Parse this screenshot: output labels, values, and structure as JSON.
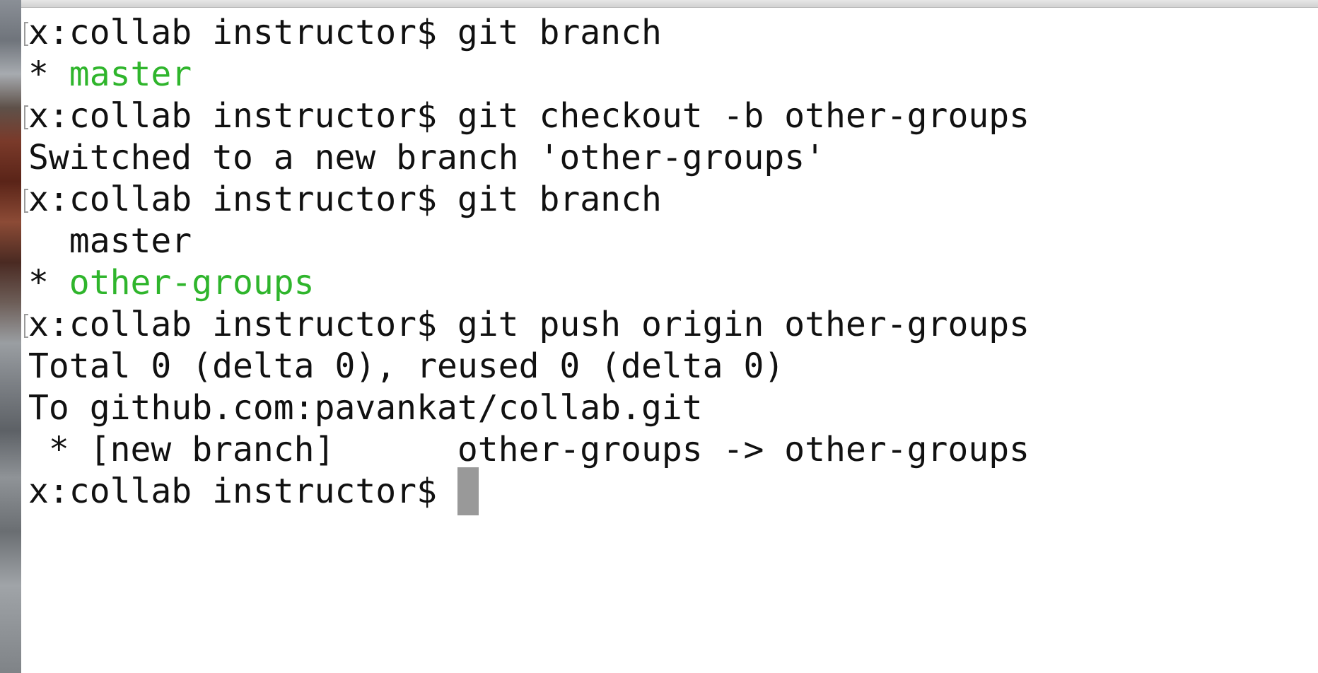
{
  "terminal": {
    "prompt": "x:collab instructor$ ",
    "lines": [
      {
        "type": "prompt",
        "command": "git branch"
      },
      {
        "type": "branch",
        "star": "* ",
        "name": "master"
      },
      {
        "type": "prompt",
        "command": "git checkout -b other-groups"
      },
      {
        "type": "output",
        "text": "Switched to a new branch 'other-groups'"
      },
      {
        "type": "prompt",
        "command": "git branch"
      },
      {
        "type": "output",
        "text": "  master"
      },
      {
        "type": "branch",
        "star": "* ",
        "name": "other-groups"
      },
      {
        "type": "prompt",
        "command": "git push origin other-groups"
      },
      {
        "type": "output",
        "text": "Total 0 (delta 0), reused 0 (delta 0)"
      },
      {
        "type": "output",
        "text": "To github.com:pavankat/collab.git"
      },
      {
        "type": "output",
        "text": " * [new branch]      other-groups -> other-groups"
      },
      {
        "type": "prompt",
        "command": ""
      }
    ]
  },
  "colors": {
    "text": "#111111",
    "current_branch": "#2fb52c",
    "cursor": "#999999",
    "background": "#ffffff"
  }
}
